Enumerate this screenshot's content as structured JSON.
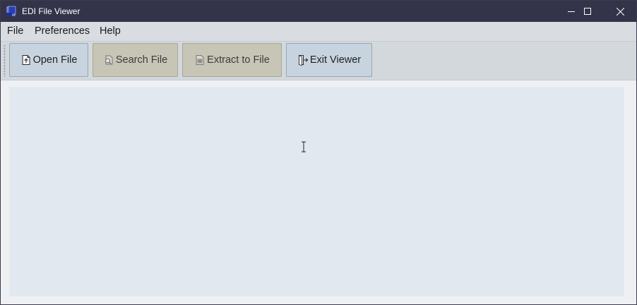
{
  "window": {
    "title": "EDI File Viewer",
    "app_icon": "edi-app-icon",
    "controls": {
      "minimize": "minimize-icon",
      "maximize": "maximize-icon",
      "close": "close-icon"
    }
  },
  "menubar": {
    "items": [
      {
        "label": "File"
      },
      {
        "label": "Preferences"
      },
      {
        "label": "Help"
      }
    ]
  },
  "toolbar": {
    "buttons": [
      {
        "label": "Open File",
        "icon": "open-file-icon",
        "state": "enabled"
      },
      {
        "label": "Search File",
        "icon": "search-file-icon",
        "state": "disabled"
      },
      {
        "label": "Extract to File",
        "icon": "extract-file-icon",
        "state": "disabled"
      },
      {
        "label": "Exit Viewer",
        "icon": "exit-icon",
        "state": "enabled"
      }
    ]
  },
  "content": {
    "text": "",
    "cursor": "text-cursor-icon"
  },
  "colors": {
    "titlebar": "#33334a",
    "menubar": "#d9dde2",
    "toolbar": "#d3d8dd",
    "button_enabled": "#c7d4df",
    "button_disabled": "#c6c5b6",
    "content_panel": "#e1e8ef"
  }
}
